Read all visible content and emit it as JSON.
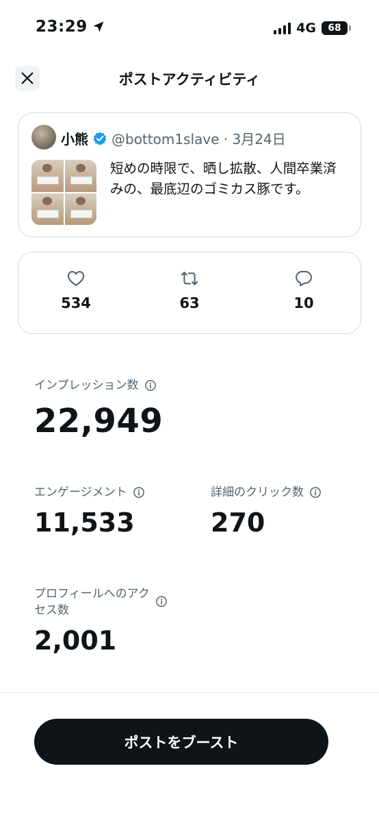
{
  "status_bar": {
    "time": "23:29",
    "network": "4G",
    "battery": "68"
  },
  "header": {
    "title": "ポストアクティビティ"
  },
  "post": {
    "author_name": "小熊",
    "handle": "@bottom1slave · 3月24日",
    "text": "短めの時限で、晒し拡散、人間卒業済みの、最底辺のゴミカス豚です。"
  },
  "stats": {
    "likes": "534",
    "reposts": "63",
    "replies": "10"
  },
  "metrics": {
    "impressions_label": "インプレッション数",
    "impressions_value": "22,949",
    "engagement_label": "エンゲージメント",
    "engagement_value": "11,533",
    "detail_clicks_label": "詳細のクリック数",
    "detail_clicks_value": "270",
    "profile_visits_label": "プロフィールへのアクセス数",
    "profile_visits_value": "2,001"
  },
  "actions": {
    "boost_label": "ポストをブースト"
  },
  "colors": {
    "text_primary": "#0f1419",
    "text_secondary": "#536471",
    "border": "#cfd9de",
    "verified_blue": "#1d9bf0",
    "button_bg": "#0f1419"
  }
}
